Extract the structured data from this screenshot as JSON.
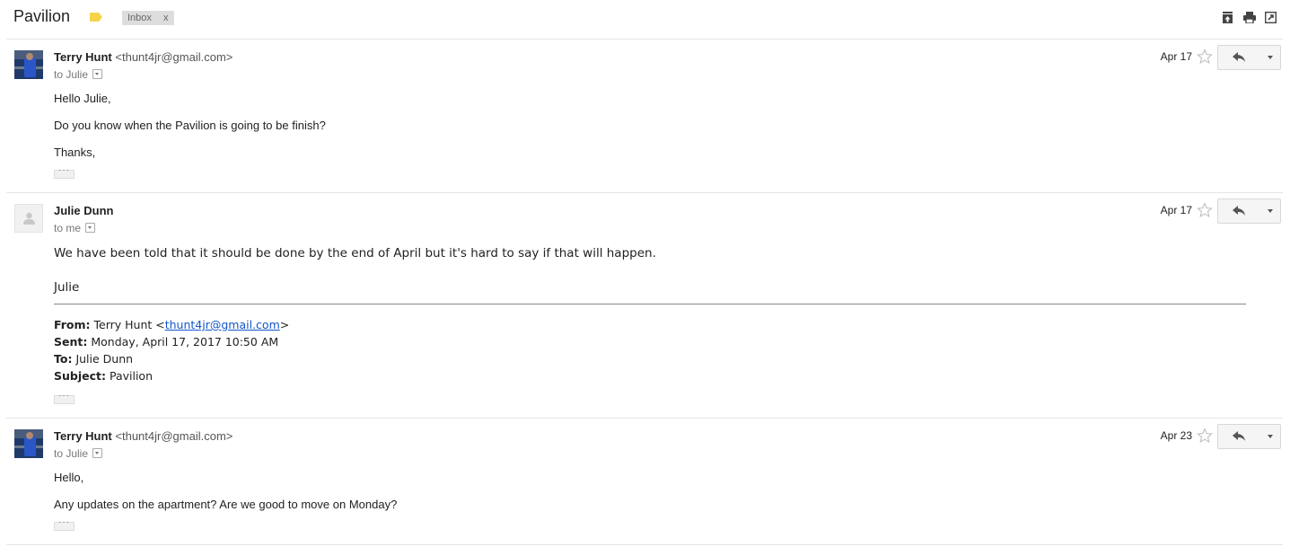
{
  "subject": {
    "title": "Pavilion",
    "label_chip": "Inbox",
    "label_chip_remove": "x",
    "label_color": "#f5d34a"
  },
  "toolbar": {
    "icons": [
      "expand-all-icon",
      "print-icon",
      "new-window-icon"
    ]
  },
  "messages": [
    {
      "sender_name": "Terry Hunt",
      "sender_email": "<thunt4jr@gmail.com>",
      "recipient": "to Julie",
      "date": "Apr 17",
      "avatar": "photo",
      "body": [
        "Hello Julie,",
        "Do you know when the Pavilion is going to be finish?",
        "Thanks,"
      ]
    },
    {
      "sender_name": "Julie Dunn",
      "sender_email": "",
      "recipient": "to me",
      "date": "Apr 17",
      "avatar": "blank",
      "body": [
        "We have been told that it should be done by the end of April but it's hard to say if that will happen.",
        "Julie"
      ],
      "forwarded": {
        "from_label": "From:",
        "from_name": "Terry Hunt <",
        "from_link": "thunt4jr@gmail.com",
        "from_close": ">",
        "sent_label": "Sent:",
        "sent_value": "Monday, April 17, 2017 10:50 AM",
        "to_label": "To:",
        "to_value": "Julie Dunn",
        "subject_label": "Subject:",
        "subject_value": "Pavilion"
      }
    },
    {
      "sender_name": "Terry Hunt",
      "sender_email": "<thunt4jr@gmail.com>",
      "recipient": "to Julie",
      "date": "Apr 23",
      "avatar": "photo",
      "body": [
        "Hello,",
        "Any updates on the apartment? Are we good to move on Monday?"
      ]
    }
  ]
}
